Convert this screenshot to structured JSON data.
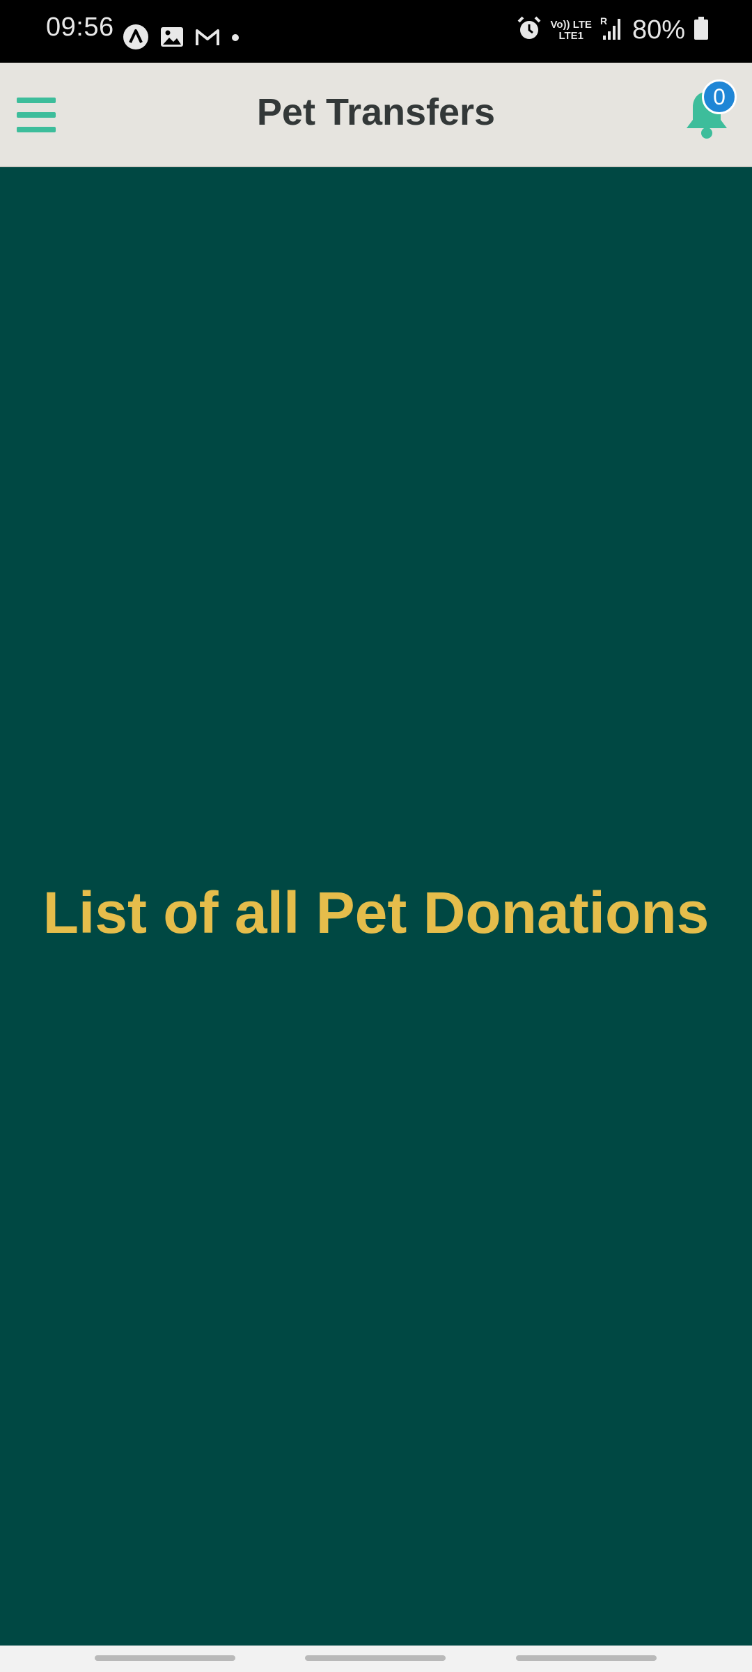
{
  "status_bar": {
    "time": "09:56",
    "battery": "80%",
    "network_top": "Vo)) LTE",
    "network_bottom": "LTE1",
    "roaming": "R",
    "icons": [
      "app-icon",
      "gallery-icon",
      "gmail-icon",
      "dot-icon",
      "alarm-icon",
      "volte-icon",
      "signal-icon",
      "battery-icon"
    ]
  },
  "app_bar": {
    "title": "Pet Transfers",
    "notification_count": "0"
  },
  "main": {
    "heading": "List of all Pet Donations"
  },
  "colors": {
    "background": "#004843",
    "app_bar": "#e6e4df",
    "accent": "#3dbd9b",
    "heading": "#e5bd4b",
    "badge": "#1f86d6"
  }
}
